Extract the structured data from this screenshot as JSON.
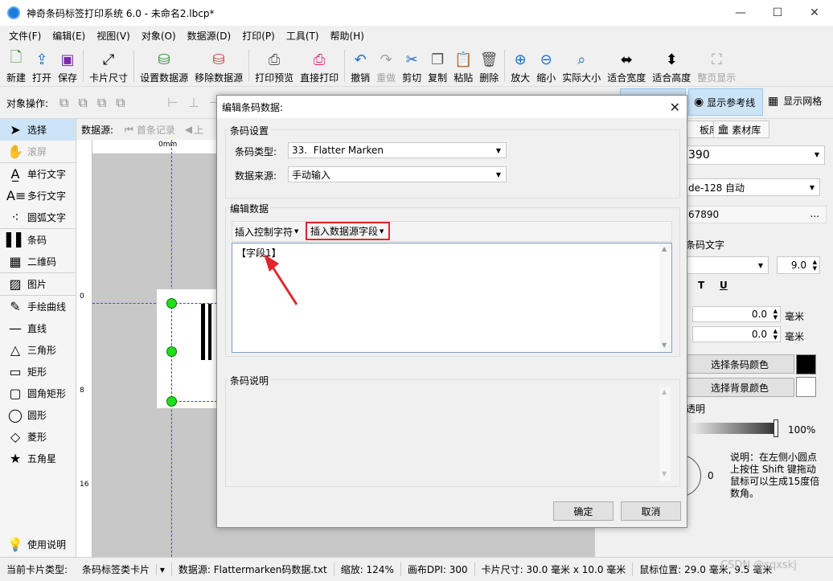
{
  "window": {
    "title": "神奇条码标签打印系统 6.0 - 未命名2.lbcp*"
  },
  "menu": [
    "文件(F)",
    "编辑(E)",
    "视图(V)",
    "对象(O)",
    "数据源(D)",
    "打印(P)",
    "工具(T)",
    "帮助(H)"
  ],
  "toolbar": {
    "new": "新建",
    "open": "打开",
    "save": "保存",
    "card_size": "卡片尺寸",
    "set_ds": "设置数据源",
    "remove_ds": "移除数据源",
    "preview": "打印预览",
    "print": "直接打印",
    "undo": "撤销",
    "redo": "重做",
    "cut": "剪切",
    "copy": "复制",
    "paste": "粘贴",
    "delete": "删除",
    "zoom_in": "放大",
    "zoom_out": "缩小",
    "actual": "实际大小",
    "fit_width": "适合宽度",
    "fit_height": "适合高度",
    "full_page": "整页显示"
  },
  "objbar": {
    "label": "对象操作:",
    "show_guides": "显示参考线",
    "show_grid": "显示网格"
  },
  "left_tools": {
    "select": "选择",
    "scroll": "滚屏",
    "single_text": "单行文字",
    "multi_text": "多行文字",
    "arc_text": "圆弧文字",
    "barcode": "条码",
    "qrcode": "二维码",
    "image": "图片",
    "freehand": "手绘曲线",
    "line": "直线",
    "triangle": "三角形",
    "rect": "矩形",
    "round_rect": "圆角矩形",
    "circle": "圆形",
    "diamond": "菱形",
    "star": "五角星",
    "help": "使用说明"
  },
  "canvasbar": {
    "ds_label": "数据源:",
    "first": "首条记录",
    "prev": "上"
  },
  "ruler": {
    "unit": "0mm",
    "v0": "0",
    "v8": "8",
    "v16": "16"
  },
  "right_panel": {
    "tab_template": "板库",
    "tab_assets": "素材库",
    "value1": "390",
    "encoding": "de-128 自动",
    "value2": "67890",
    "more": "...",
    "show_text": "条码文字",
    "font_size": "9.0",
    "bold_t": "T",
    "underline_u": "U",
    "offset1": "0.0",
    "offset2": "0.0",
    "unit": "毫米",
    "barcode_color": "选择条码颜色",
    "bg_color": "选择背景颜色",
    "transparency": "透明",
    "percent": "100%",
    "rot_val": "0",
    "note": "说明：在左侧小圆点上按住 Shift 键拖动鼠标可以生成15度倍数角。"
  },
  "dialog": {
    "title": "编辑条码数据:",
    "group_settings": "条码设置",
    "type_label": "条码类型:",
    "type_value": "33.  Flatter Marken",
    "source_label": "数据来源:",
    "source_value": "手动输入",
    "group_edit": "编辑数据",
    "insert_ctrl": "插入控制字符",
    "insert_field": "插入数据源字段",
    "content": "【字段1】",
    "group_desc": "条码说明",
    "ok": "确定",
    "cancel": "取消"
  },
  "status": {
    "card_type": "当前卡片类型:",
    "card_type_value": "条码标签类卡片",
    "ds": "数据源: Flattermarken码数据.txt",
    "zoom": "缩放: 124%",
    "dpi": "画布DPI: 300",
    "size": "卡片尺寸: 30.0 毫米 x 10.0 毫米",
    "pos": "鼠标位置: 29.0 毫米, 9.5 毫米"
  },
  "watermark": "CSDN @sqxskj",
  "colors": {
    "accent": "#0078d7",
    "highlight_box": "#e0262e",
    "handle": "#1ee01e"
  }
}
